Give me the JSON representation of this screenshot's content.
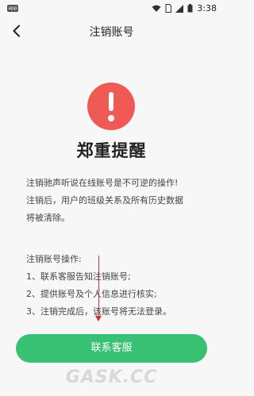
{
  "status_bar": {
    "badge": "app",
    "time": "3:38"
  },
  "header": {
    "title": "注销账号"
  },
  "alert": {
    "heading": "郑重提醒"
  },
  "notice": {
    "lines": [
      "注销驰声听说在线账号是不可逆的操作!",
      "注销后，用户的班级关系及所有历史数据",
      "将被清除。"
    ]
  },
  "steps": {
    "title": "注销账号操作:",
    "items": [
      "1、联系客服告知注销账号;",
      "2、提供账号及个人信息进行核实;",
      "3、注销完成后，该账号将无法登录。"
    ]
  },
  "contact_button": {
    "label": "联系客服"
  },
  "watermark": "GASK.CC",
  "colors": {
    "accent": "#38c172",
    "warning": "#ef5a55"
  }
}
